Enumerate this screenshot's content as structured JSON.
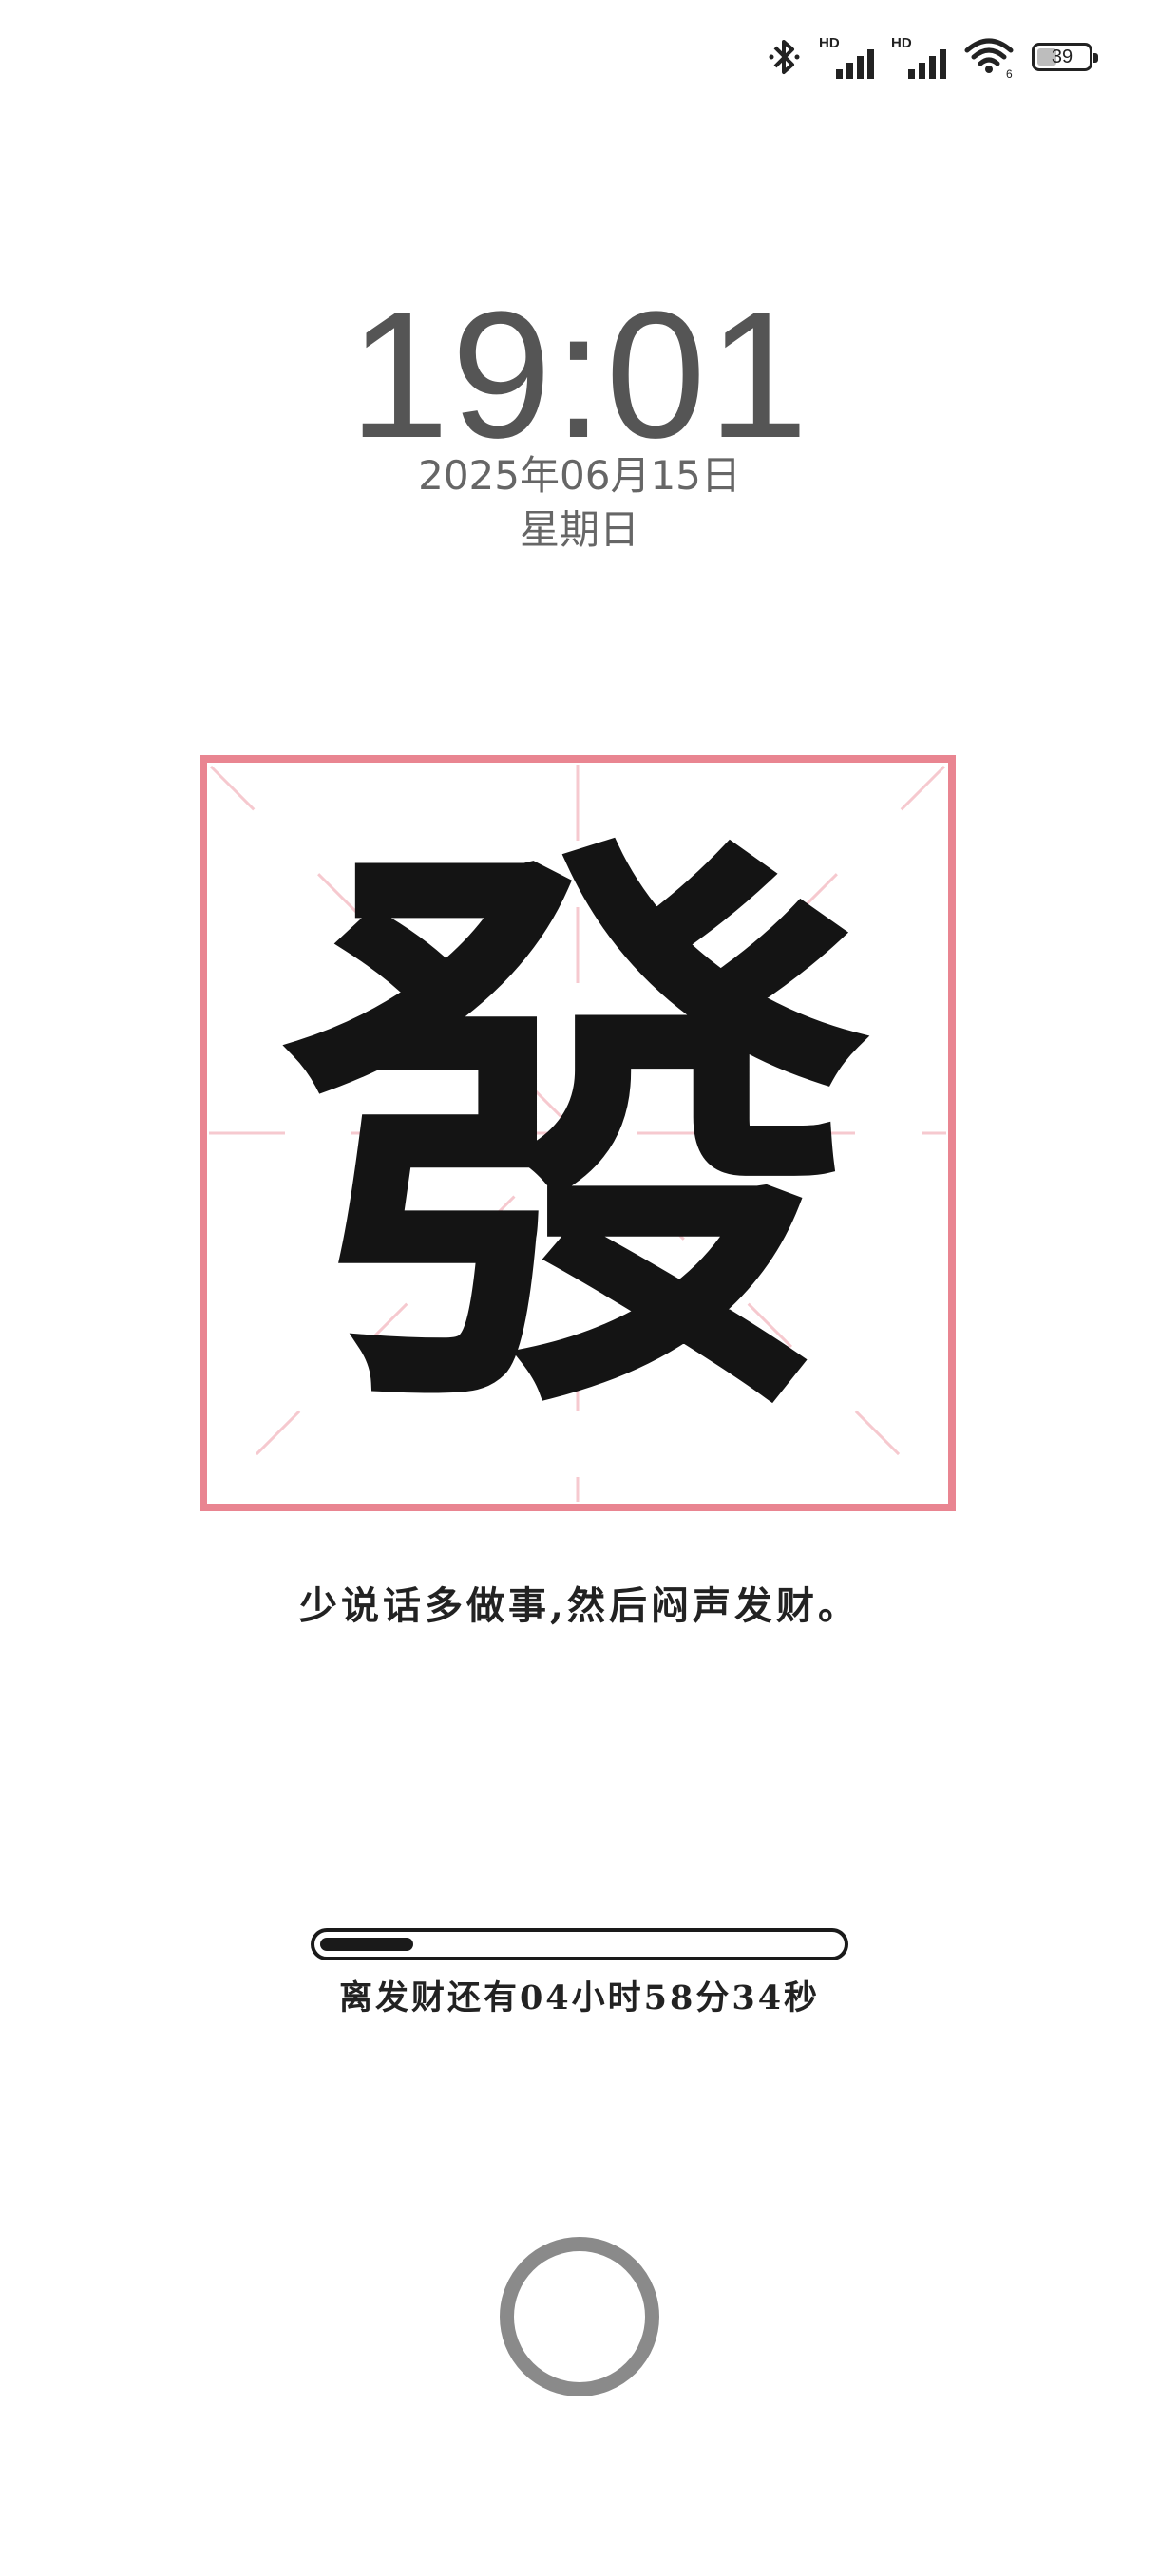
{
  "status_bar": {
    "bluetooth_icon": "bluetooth-icon",
    "signal1_label": "HD",
    "signal2_label": "HD",
    "wifi_icon": "wifi-icon",
    "wifi_badge": "6",
    "battery_level": "39"
  },
  "lock": {
    "time": "19:01",
    "date": "2025年06月15日",
    "weekday": "星期日"
  },
  "widget": {
    "character": "發",
    "grid_color": "#e98591",
    "guide_color": "#f6c9cf",
    "motto": "少说话多做事,然后闷声发财。",
    "progress_fraction": 0.18,
    "countdown": "离发财还有04小时58分34秒"
  },
  "home": {
    "button_icon": "circle-home-icon"
  }
}
